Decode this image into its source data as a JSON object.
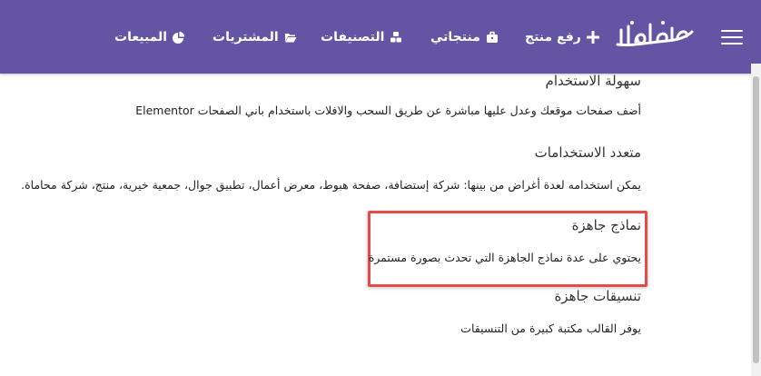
{
  "nav": {
    "logo_text": "بيكاليما",
    "items": [
      {
        "label": "رفع منتج",
        "icon": "plus-icon"
      },
      {
        "label": "منتجاتي",
        "icon": "briefcase-icon"
      },
      {
        "label": "التصنيفات",
        "icon": "cubes-icon"
      },
      {
        "label": "المشتريات",
        "icon": "folder-open-icon"
      },
      {
        "label": "المبيعات",
        "icon": "pie-chart-icon"
      }
    ]
  },
  "sections": [
    {
      "title": "سهولة الاستخدام",
      "text": "أضف صفحات موقعك وعدل عليها مباشرة عن طريق السحب والافلات باستخدام باني الصفحات Elementor"
    },
    {
      "title": "متعدد الاستخدامات",
      "text": "يمكن استخدامه لعدة أغراض من بينها: شركة إستضافة، صفحة هبوط، معرض أعمال، تطبيق جوال، جمعية خيرية، منتج، شركة محاماة."
    },
    {
      "title": "نماذج جاهزة",
      "text": "يحتوي على عدة نماذج الجاهزة التي تحدث بصورة مستمرة"
    },
    {
      "title": "تنسيقات جاهزة",
      "text": "يوفر القالب مكتبة كبيرة من التنسيقات"
    }
  ],
  "colors": {
    "navbar": "#6355a4",
    "highlight": "#e44b4b"
  }
}
